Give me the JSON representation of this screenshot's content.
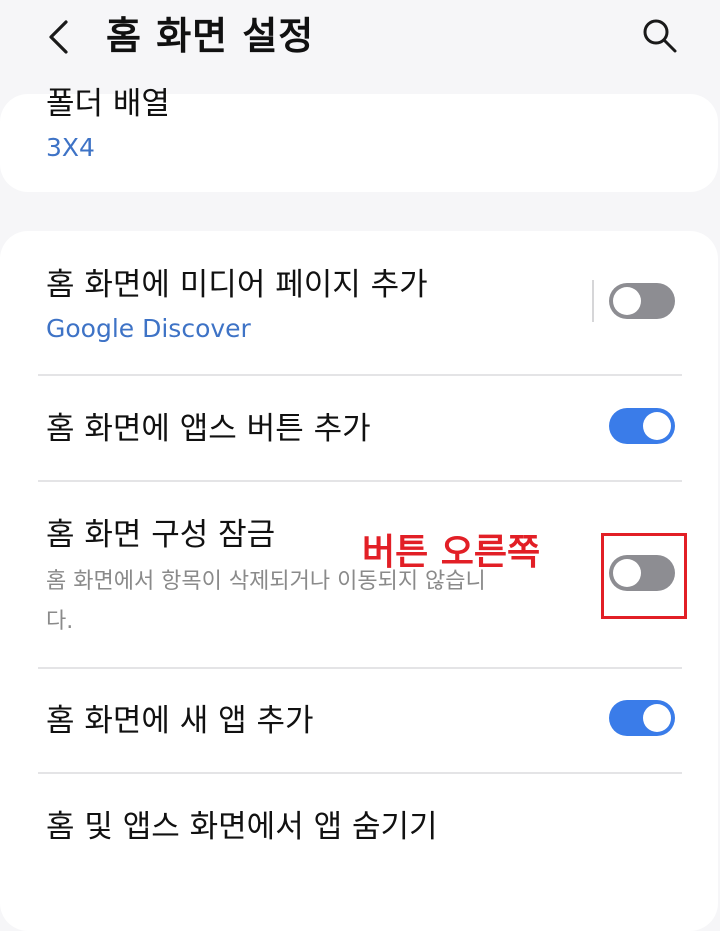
{
  "header": {
    "title": "홈 화면 설정",
    "back_icon": "chevron-left-icon",
    "search_icon": "search-icon"
  },
  "folder_grid": {
    "title": "폴더 배열",
    "value": "3X4"
  },
  "settings": [
    {
      "title": "홈 화면에 미디어 페이지 추가",
      "subtitle": "Google Discover",
      "toggle": "off"
    },
    {
      "title": "홈 화면에 앱스 버튼 추가",
      "toggle": "on"
    },
    {
      "title": "홈 화면 구성 잠금",
      "description": "홈 화면에서 항목이 삭제되거나 이동되지 않습니다.",
      "toggle": "off"
    },
    {
      "title": "홈 화면에 새 앱 추가",
      "toggle": "on"
    },
    {
      "title": "홈 및 앱스 화면에서 앱 숨기기"
    }
  ],
  "annotation": {
    "label": "버튼 오른쪽",
    "color": "#e21f26"
  },
  "colors": {
    "accent": "#3a7ce9",
    "link_text": "#3e73c6",
    "toggle_off": "#8d8d92",
    "background": "#f6f6f8"
  }
}
